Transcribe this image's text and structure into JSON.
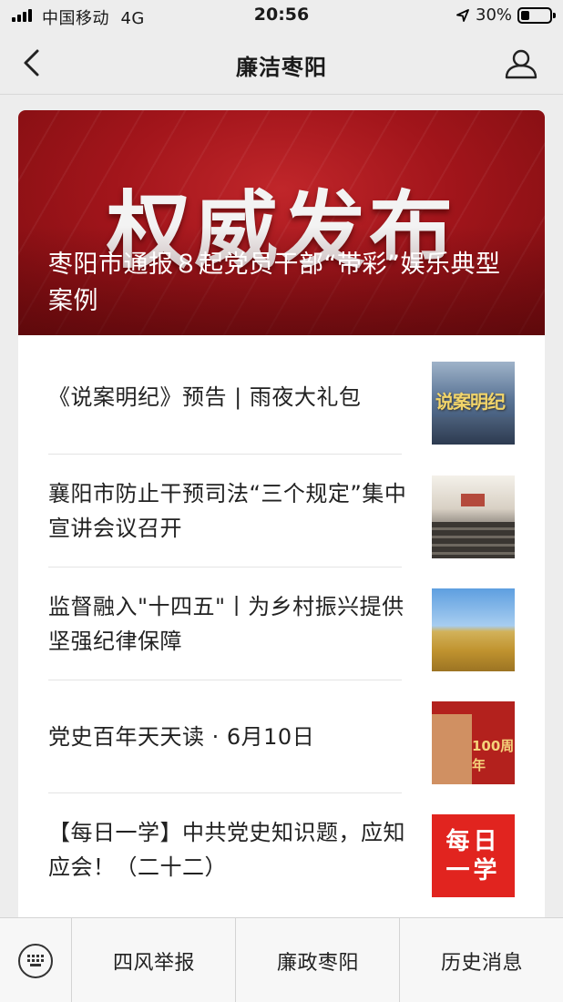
{
  "status_bar": {
    "carrier": "中国移动  4G",
    "time": "20:56",
    "battery_text": "30%",
    "battery_level": 0.3
  },
  "nav": {
    "title": "廉洁枣阳",
    "back_icon": "chevron-left-icon",
    "user_icon": "person-icon"
  },
  "banner": {
    "headline": "权威发布",
    "title": "枣阳市通报８起党员干部“带彩”娱乐典型案例"
  },
  "articles": [
    {
      "title": "《说案明纪》预告 | 雨夜大礼包",
      "thumb_text": "说案明纪"
    },
    {
      "title": "襄阳市防止干预司法“三个规定”集中宣讲会议召开"
    },
    {
      "title": "监督融入\"十四五\"丨为乡村振兴提供坚强纪律保障"
    },
    {
      "title": "党史百年天天读 · 6月10日",
      "thumb_text": "100周年"
    },
    {
      "title": "【每日一学】中共党史知识题，应知应会！（二十二）",
      "thumb_text": "每日一学"
    }
  ],
  "bottom_menu": {
    "keyboard_icon": "keyboard-icon",
    "items": [
      "四风举报",
      "廉政枣阳",
      "历史消息"
    ]
  }
}
